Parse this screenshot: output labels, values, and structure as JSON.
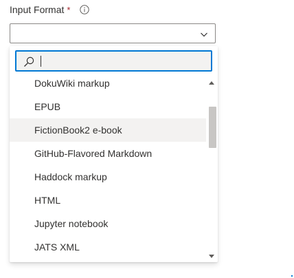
{
  "field": {
    "label": "Input Format",
    "required_mark": "*",
    "info_icon": "info-icon"
  },
  "dropdown": {
    "selected_value": "",
    "chevron_icon": "chevron-down-icon"
  },
  "search": {
    "placeholder": "",
    "value": "",
    "icon": "search-icon"
  },
  "options": [
    {
      "label": "DokuWiki markup"
    },
    {
      "label": "EPUB"
    },
    {
      "label": "FictionBook2 e-book",
      "hovered": true
    },
    {
      "label": "GitHub-Flavored Markdown"
    },
    {
      "label": "Haddock markup"
    },
    {
      "label": "HTML"
    },
    {
      "label": "Jupyter notebook"
    },
    {
      "label": "JATS XML"
    }
  ],
  "colors": {
    "accent": "#0078d4",
    "required": "#a4262c",
    "hover_bg": "#f3f2f1",
    "text": "#323130"
  }
}
